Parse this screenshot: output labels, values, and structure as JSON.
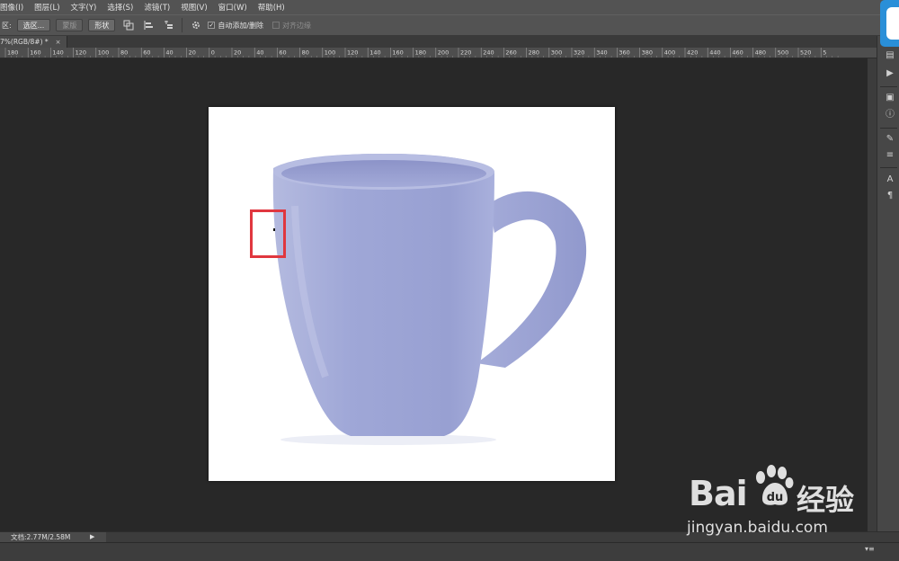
{
  "menubar": {
    "items": [
      "图像(I)",
      "图层(L)",
      "文字(Y)",
      "选择(S)",
      "滤镜(T)",
      "视图(V)",
      "窗口(W)",
      "帮助(H)"
    ]
  },
  "options": {
    "label": "区:",
    "btn_selection": "选区...",
    "btn_mask": "蒙版",
    "btn_shape": "形状",
    "auto_add_delete": "自动添加/删除",
    "align_edges": "对齐边缘",
    "auto_add_checked": true,
    "align_edges_checked": false
  },
  "document": {
    "tab_title": "7%(RGB/8#) *",
    "tab_close": "×"
  },
  "ruler": {
    "labels": [
      "180",
      "160",
      "140",
      "120",
      "100",
      "80",
      "60",
      "40",
      "20",
      "0",
      "20",
      "40",
      "60",
      "80",
      "100",
      "120",
      "140",
      "160",
      "180",
      "200",
      "220",
      "240",
      "260",
      "280",
      "300",
      "320",
      "340",
      "360",
      "380",
      "400",
      "420",
      "440",
      "460",
      "480",
      "500",
      "520",
      "5"
    ]
  },
  "status": {
    "doc_info": "文档:2.77M/2.58M",
    "arrow": "▶"
  },
  "watermark": {
    "logo": "Bai",
    "logo_suffix": "经验",
    "url": "jingyan.baidu.com"
  },
  "colors": {
    "selection_box": "#e0373f",
    "mug": "#9ea6d8",
    "panel_accent": "#2a8fd8"
  }
}
